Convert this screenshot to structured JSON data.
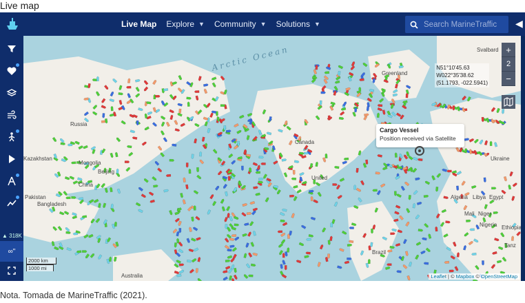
{
  "captions": {
    "top": "Live map",
    "bottom": "Nota. Tomada de MarineTraffic (2021)."
  },
  "topbar": {
    "nav": [
      {
        "label": "Live Map",
        "active": true
      },
      {
        "label": "Explore"
      },
      {
        "label": "Community"
      },
      {
        "label": "Solutions"
      }
    ],
    "search_placeholder": "Search MarineTraffic"
  },
  "sidebar": {
    "icons": [
      "filter-icon",
      "heart-icon",
      "layers-icon",
      "wind-icon",
      "route-icon",
      "play-icon",
      "compass-icon",
      "chart-icon"
    ],
    "vessel_count": "318K",
    "infinity_label": "∞\""
  },
  "map": {
    "ocean_label": "Arctic Ocean",
    "places": {
      "greenland": "Greenland",
      "russia": "Russia",
      "canada": "Canada",
      "kazakhstan": "Kazakhstan",
      "mongolia": "Mongolia",
      "beijing": "Beijing",
      "china": "China",
      "pakistan": "Pakistan",
      "bangladesh": "Bangladesh",
      "united": "United",
      "algeria": "Algeria",
      "libya": "Libya",
      "egypt": "Egypt",
      "mali": "Mali",
      "niger": "Niger",
      "nigeria": "Nigeria",
      "ethiopia": "Ethiopia",
      "ukraine": "Ukraine",
      "tanzania": "Tanz",
      "brazil": "Brazil",
      "australia": "Australia",
      "svalbard": "Svalbard"
    },
    "zoom_level": "2",
    "coordinates": [
      "N51°10'45.63",
      "W022°35'38.62",
      "(51.1793, -022.5941)"
    ],
    "popup": {
      "title": "Cargo Vessel",
      "subtitle": "Position received via Satellite"
    },
    "scale": [
      "2000 km",
      "1000 mi"
    ],
    "attribution": {
      "leaflet": "Leaflet",
      "sep1": " | © ",
      "mapbox": "Mapbox",
      "sep2": " © ",
      "osm": "OpenStreetMap"
    }
  },
  "colors": {
    "nav_bg": "#0f2d6b",
    "search_bg": "#1f4aa0",
    "ocean": "#aad3df",
    "land": "#f2efe9",
    "vessel_cargo": "#4fcf3a",
    "vessel_tanker": "#e03a3a",
    "vessel_passenger": "#3a6ee0",
    "vessel_fishing": "#f39a6b",
    "vessel_other": "#6fd3e8"
  }
}
